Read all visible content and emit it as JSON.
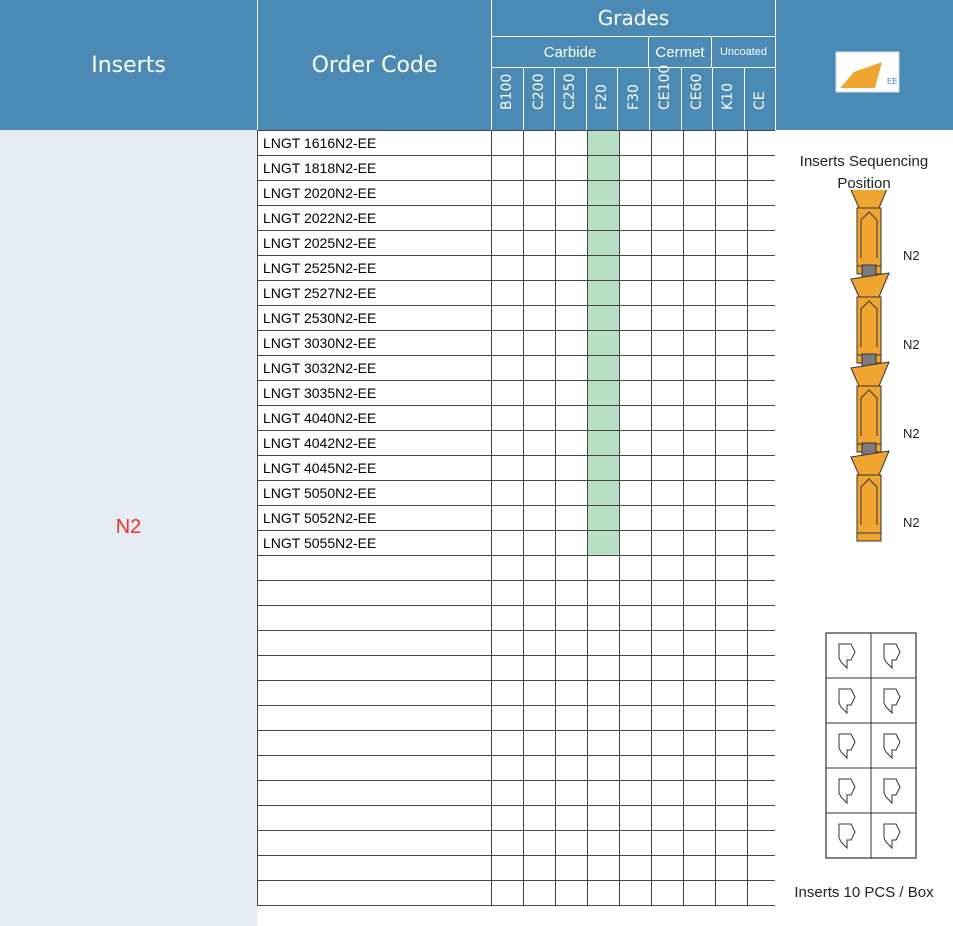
{
  "header": {
    "inserts": "Inserts",
    "order_code": "Order Code",
    "grades": "Grades",
    "groups": {
      "carbide": "Carbide",
      "cermet": "Cermet",
      "uncoated": "Uncoated"
    },
    "grade_cols": [
      "B100",
      "C200",
      "C250",
      "F20",
      "F30",
      "CE100",
      "CE60",
      "K10",
      "CE"
    ],
    "icon_label": "EE"
  },
  "inserts_label": "N2",
  "order_codes": [
    "LNGT 1616N2-EE",
    "LNGT 1818N2-EE",
    "LNGT 2020N2-EE",
    "LNGT 2022N2-EE",
    "LNGT 2025N2-EE",
    "LNGT 2525N2-EE",
    "LNGT 2527N2-EE",
    "LNGT 2530N2-EE",
    "LNGT 3030N2-EE",
    "LNGT 3032N2-EE",
    "LNGT 3035N2-EE",
    "LNGT 4040N2-EE",
    "LNGT 4042N2-EE",
    "LNGT 4045N2-EE",
    "LNGT 5050N2-EE",
    "LNGT 5052N2-EE",
    "LNGT 5055N2-EE",
    "",
    "",
    "",
    "",
    "",
    "",
    "",
    "",
    "",
    "",
    "",
    "",
    "",
    ""
  ],
  "available_grade": "F20",
  "sequencing": {
    "title_line1": "Inserts Sequencing",
    "title_line2": "Position",
    "positions": [
      "N2",
      "N2",
      "N2",
      "N2"
    ]
  },
  "box_label": "Inserts 10 PCS / Box",
  "colors": {
    "header": "#4a8ab4",
    "available": "#b8e0c5",
    "insert_gold": "#f0a531",
    "label_red": "#e8312a"
  }
}
